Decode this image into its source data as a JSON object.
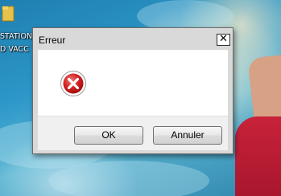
{
  "desktop": {
    "icon_name": "folder-icon",
    "icon_label_line1": "STATION",
    "icon_label_line2": "D VACC"
  },
  "dialog": {
    "title": "Erreur",
    "close_glyph": "✕",
    "icon_name": "error-icon",
    "buttons": {
      "ok_label": "OK",
      "cancel_label": "Annuler"
    }
  }
}
